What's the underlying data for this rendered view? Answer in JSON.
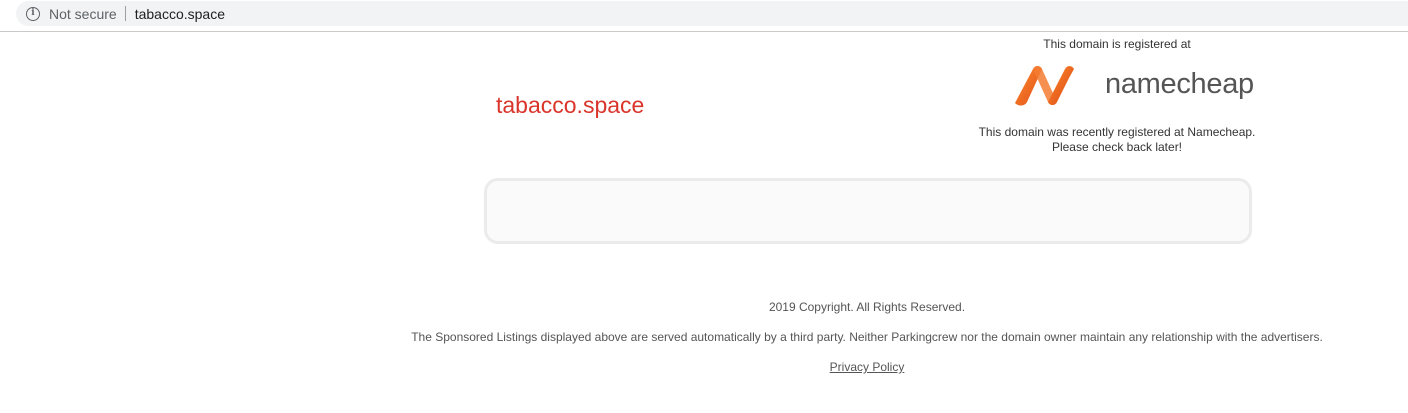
{
  "browser": {
    "security_label": "Not secure",
    "url": "tabacco.space"
  },
  "page": {
    "domain_title": "tabacco.space",
    "registered_at_label": "This domain is registered at",
    "registrar_logo_text": "namecheap",
    "recent_line1": "This domain was recently registered at Namecheap.",
    "recent_line2": "Please check back later!",
    "copyright": "2019 Copyright. All Rights Reserved.",
    "disclaimer": "The Sponsored Listings displayed above are served automatically by a third party. Neither Parkingcrew nor the domain owner maintain any relationship with the advertisers.",
    "privacy_link": "Privacy Policy"
  },
  "colors": {
    "domain_title": "#d9352b",
    "logo_orange": "#f26b21",
    "text_gray": "#555555"
  },
  "icons": {
    "security": "info-icon",
    "logo": "namecheap-logo-icon"
  }
}
